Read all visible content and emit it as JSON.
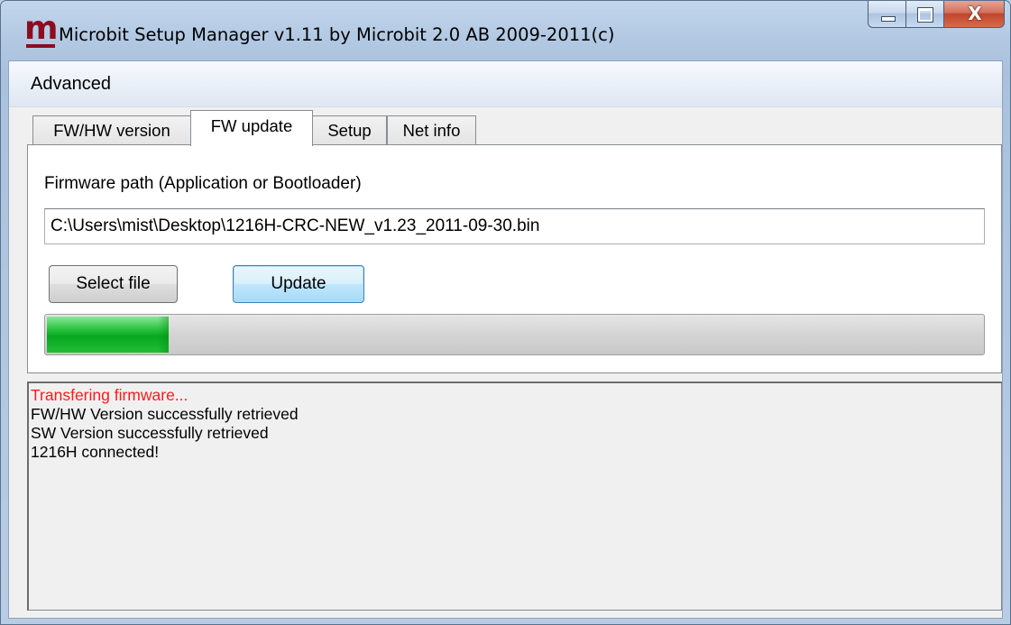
{
  "window": {
    "title": "Microbit Setup Manager v1.11 by Microbit 2.0 AB 2009-2011(c)",
    "logo_letter": "m",
    "logo_color": "#8b0d1f",
    "caption_icons": [
      "minimize-icon",
      "maximize-icon",
      "close-icon"
    ],
    "close_glyph": "X"
  },
  "menu": {
    "items": [
      "Advanced"
    ]
  },
  "tabs": {
    "items": [
      "FW/HW version",
      "FW update",
      "Setup",
      "Net info"
    ],
    "selected": "FW update"
  },
  "fw_update": {
    "path_label": "Firmware path (Application or Bootloader)",
    "path_value": "C:\\Users\\mist\\Desktop\\1216H-CRC-NEW_v1.23_2011-09-30.bin",
    "select_button": "Select file",
    "update_button": "Update",
    "progress_fraction": 0.13,
    "progress_color": "#06a81f"
  },
  "log": {
    "lines": [
      {
        "text": "Transfering firmware...",
        "color": "#ff1a1a"
      },
      {
        "text": "FW/HW Version successfully retrieved",
        "color": "#000000"
      },
      {
        "text": "SW Version successfully retrieved",
        "color": "#000000"
      },
      {
        "text": "1216H connected!",
        "color": "#000000"
      }
    ]
  }
}
